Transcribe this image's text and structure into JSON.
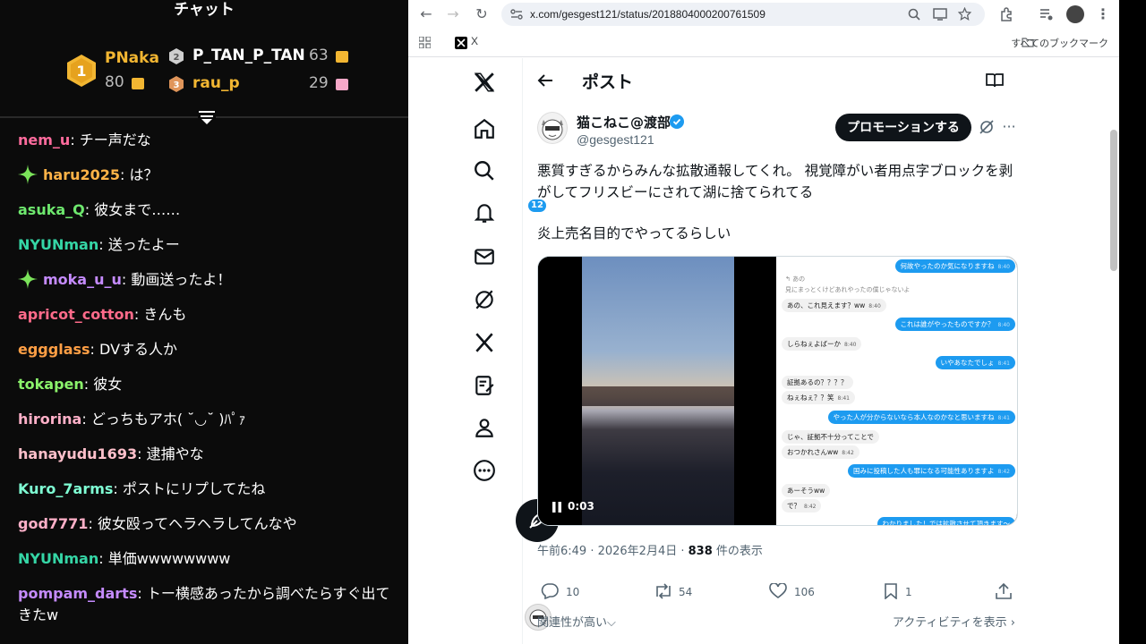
{
  "chat": {
    "title": "チャット",
    "ranking": [
      {
        "rank": "1",
        "name": "PNaka",
        "count": "80",
        "color": "#f2b632"
      },
      {
        "rank": "2",
        "name": "P_TAN_P_TAN",
        "count": "63",
        "color": "#d0d0d0"
      },
      {
        "rank": "3",
        "name": "rau_p",
        "count": "29",
        "color": "#e0955a"
      }
    ],
    "messages": [
      {
        "user": "nem_u",
        "text": "チー声だな",
        "color": "#ff6b9d",
        "sparkle": false
      },
      {
        "user": "haru2025",
        "text": "は？",
        "color": "#ffb347",
        "sparkle": true
      },
      {
        "user": "asuka_Q",
        "text": "彼女まで……",
        "color": "#6ee86e",
        "sparkle": false
      },
      {
        "user": "NYUNman",
        "text": "送ったよー",
        "color": "#35d6a6",
        "sparkle": false
      },
      {
        "user": "moka_u_u",
        "text": "動画送ったよ！",
        "color": "#c58bff",
        "sparkle": true
      },
      {
        "user": "apricot_cotton",
        "text": "きんも",
        "color": "#ff6b8a",
        "sparkle": false
      },
      {
        "user": "eggglass",
        "text": "DVする人か",
        "color": "#ff9f45",
        "sparkle": false
      },
      {
        "user": "tokapen",
        "text": "彼女",
        "color": "#8bf36b",
        "sparkle": false
      },
      {
        "user": "hirorina",
        "text": "どっちもアホ( ˘◡˘ )ﾊﾟｧ",
        "color": "#ffb0c8",
        "sparkle": false
      },
      {
        "user": "hanayudu1693",
        "text": "逮捕やな",
        "color": "#ffc0cb",
        "sparkle": false
      },
      {
        "user": "Kuro_7arms",
        "text": "ポストにリプしてたね",
        "color": "#7fffd4",
        "sparkle": false
      },
      {
        "user": "god7771",
        "text": "彼女殴ってヘラヘラしてんなや",
        "color": "#ffb0c8",
        "sparkle": false
      },
      {
        "user": "NYUNman",
        "text": "単価wwwwwwww",
        "color": "#35d6a6",
        "sparkle": false
      },
      {
        "user": "pompam_darts",
        "text": "トー横感あったから調べたらすぐ出てきたw",
        "color": "#c58bff",
        "sparkle": false
      }
    ]
  },
  "browser": {
    "url": "x.com/gesgest121/status/2018804000200761509",
    "bookmark_x": "X",
    "bookmark_all": "すべてのブックマーク"
  },
  "x": {
    "page_title": "ポスト",
    "notification_count": "12",
    "author": {
      "display_name": "猫こねこ@渡部",
      "handle": "@gesgest121"
    },
    "promote_label": "プロモーションする",
    "text_line1": "悪質すぎるからみんな拡散通報してくれ。 視覚障がい者用点字ブロックを剥がしてフリスビーにされて湖に捨てられてる",
    "text_line2": "炎上売名目的でやってるらしい",
    "video_time": "0:03",
    "meta": {
      "time": "午前6:49 · 2026年2月4日 · ",
      "views": "838",
      "views_suffix": " 件の表示"
    },
    "actions": {
      "replies": "10",
      "reposts": "54",
      "likes": "106",
      "bookmarks": "1"
    },
    "related": "関連性が高い⌵",
    "activity": "アクティビティを表示 ›",
    "screenshot_chat": [
      {
        "side": "me",
        "text": "何故やったのか気になりますね",
        "time": "8:40"
      },
      {
        "side": "quote",
        "text": "↰ あの"
      },
      {
        "side": "quote",
        "text": "見にまっとくけどあれやったの僕じゃないよ"
      },
      {
        "side": "them",
        "text": "あの、これ見えます？ww",
        "time": "8:40"
      },
      {
        "side": "me",
        "text": "これは誰がやったものですか？",
        "time": "8:40"
      },
      {
        "side": "them",
        "text": "しらねぇよばーか",
        "time": "8:40"
      },
      {
        "side": "me",
        "text": "いやあなたでしょ",
        "time": "8:41"
      },
      {
        "side": "them",
        "text": "証拠あるの？？？？",
        "time": ""
      },
      {
        "side": "them",
        "text": "ねぇねぇ？？笑",
        "time": "8:41"
      },
      {
        "side": "me",
        "text": "やった人が分からないなら本人なのかなと思いますね",
        "time": "8:41"
      },
      {
        "side": "them",
        "text": "じゃ、証拠不十分ってことで",
        "time": ""
      },
      {
        "side": "them",
        "text": "おつかれさんww",
        "time": "8:42"
      },
      {
        "side": "me",
        "text": "国みに投稿した人も罪になる可能性ありますよ",
        "time": "8:42"
      },
      {
        "side": "them",
        "text": "あーそうww",
        "time": ""
      },
      {
        "side": "them",
        "text": "で？",
        "time": "8:42"
      },
      {
        "side": "me",
        "text": "わかりました！では拡散させて頂きます～",
        "time": ""
      }
    ]
  }
}
